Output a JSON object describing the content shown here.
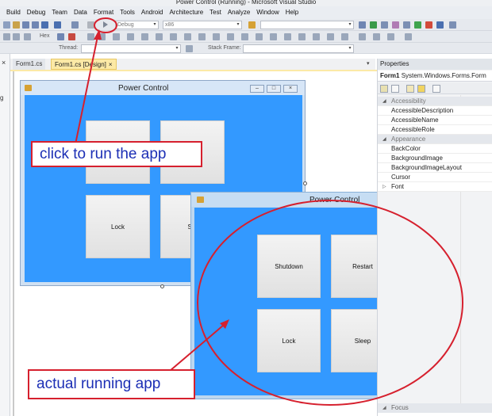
{
  "window": {
    "title": "Power Control (Running) - Microsoft Visual Studio"
  },
  "menu": [
    "Build",
    "Debug",
    "Team",
    "Data",
    "Format",
    "Tools",
    "Android",
    "Architecture",
    "Test",
    "Analyze",
    "Window",
    "Help"
  ],
  "toolbar": {
    "config_combo": "Debug",
    "platform_combo": "x86",
    "hex_label": "Hex",
    "thread_label": "Thread:",
    "stack_frame_label": "Stack Frame:"
  },
  "left_panel": {
    "close_glyph": "×",
    "partial_text": "g"
  },
  "tabs": [
    {
      "label": "Form1.cs",
      "active": false
    },
    {
      "label": "Form1.cs [Design]",
      "active": true,
      "close": "×"
    }
  ],
  "design_form": {
    "title": "Power Control",
    "buttons": [
      "",
      "",
      "Lock",
      "Sle"
    ]
  },
  "running_app": {
    "title": "Power Control",
    "close_glyph": "✕",
    "buttons": [
      "Shutdown",
      "Restart",
      "Lock",
      "Sleep"
    ]
  },
  "properties": {
    "title": "Properties",
    "object_name": "Form1",
    "object_type": "System.Windows.Forms.Form",
    "rows": [
      {
        "name": "Accessibility",
        "category": true
      },
      {
        "name": "AccessibleDescription",
        "category": false
      },
      {
        "name": "AccessibleName",
        "category": false
      },
      {
        "name": "AccessibleRole",
        "category": false
      },
      {
        "name": "Appearance",
        "category": true
      },
      {
        "name": "BackColor",
        "category": false
      },
      {
        "name": "BackgroundImage",
        "category": false
      },
      {
        "name": "BackgroundImageLayout",
        "category": false
      },
      {
        "name": "Cursor",
        "category": false
      },
      {
        "name": "Font",
        "category": false
      }
    ],
    "bottom_category": "Focus"
  },
  "annotations": {
    "run_callout": "click to run the app",
    "app_callout": "actual running app"
  },
  "colors": {
    "form_client": "#3399ff",
    "annotation_red": "#d6202e",
    "annotation_text": "#1c2fb5",
    "active_tab": "#fce9a6",
    "close_button": "#c74a41"
  }
}
